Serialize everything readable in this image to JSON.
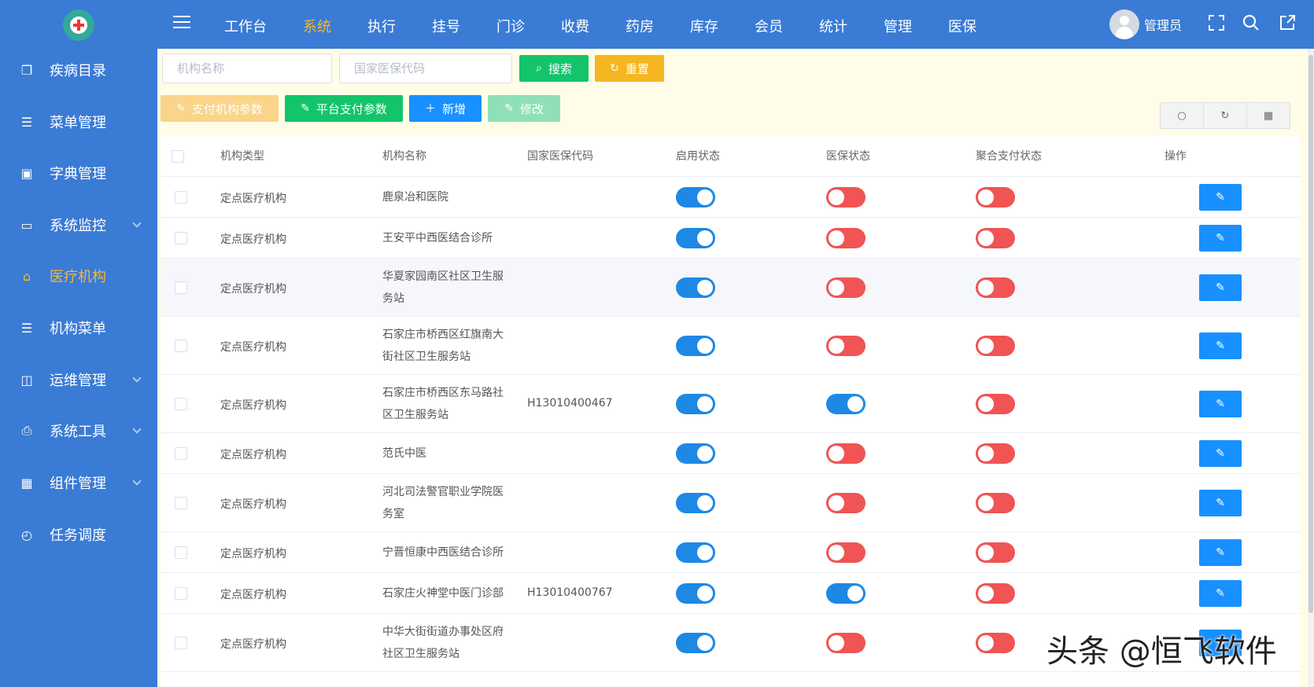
{
  "topnav": {
    "items": [
      "工作台",
      "系统",
      "执行",
      "挂号",
      "门诊",
      "收费",
      "药房",
      "库存",
      "会员",
      "统计",
      "管理",
      "医保"
    ],
    "active_index": 1
  },
  "user": {
    "name": "管理员"
  },
  "sidebar": {
    "items": [
      {
        "label": "疾病目录",
        "icon": "book-icon",
        "chevron": false
      },
      {
        "label": "菜单管理",
        "icon": "list-icon",
        "chevron": false
      },
      {
        "label": "字典管理",
        "icon": "dictionary-icon",
        "chevron": false
      },
      {
        "label": "系统监控",
        "icon": "monitor-icon",
        "chevron": true
      },
      {
        "label": "医疗机构",
        "icon": "home-icon",
        "chevron": false,
        "active": true
      },
      {
        "label": "机构菜单",
        "icon": "list-icon",
        "chevron": false
      },
      {
        "label": "运维管理",
        "icon": "screen-icon",
        "chevron": true
      },
      {
        "label": "系统工具",
        "icon": "printer-icon",
        "chevron": true
      },
      {
        "label": "组件管理",
        "icon": "grid-icon",
        "chevron": true
      },
      {
        "label": "任务调度",
        "icon": "clock-icon",
        "chevron": false
      }
    ]
  },
  "search": {
    "org_name_placeholder": "机构名称",
    "code_placeholder": "国家医保代码",
    "search_label": "搜索",
    "reset_label": "重置"
  },
  "toolbar": {
    "pay_org_params_label": "支付机构参数",
    "platform_pay_params_label": "平台支付参数",
    "add_label": "新增",
    "edit_label": "修改"
  },
  "colors": {
    "primary": "#3a7bd5",
    "accent": "#f7b731",
    "switch_on": "#1e88e5",
    "switch_off": "#f05454",
    "success": "#13c46b"
  },
  "table": {
    "columns": [
      "机构类型",
      "机构名称",
      "国家医保代码",
      "启用状态",
      "医保状态",
      "聚合支付状态",
      "操作"
    ],
    "rows": [
      {
        "type": "定点医疗机构",
        "name_lines": [
          "鹿泉冶和医院"
        ],
        "code": "",
        "enabled": true,
        "insurance": false,
        "agg_pay": false
      },
      {
        "type": "定点医疗机构",
        "name_lines": [
          "王安平中西医结合诊所"
        ],
        "code": "",
        "enabled": true,
        "insurance": false,
        "agg_pay": false
      },
      {
        "type": "定点医疗机构",
        "name_lines": [
          "华夏家园南区社区卫生服",
          "务站"
        ],
        "code": "",
        "enabled": true,
        "insurance": false,
        "agg_pay": false
      },
      {
        "type": "定点医疗机构",
        "name_lines": [
          "石家庄市桥西区红旗南大",
          "街社区卫生服务站"
        ],
        "code": "",
        "enabled": true,
        "insurance": false,
        "agg_pay": false
      },
      {
        "type": "定点医疗机构",
        "name_lines": [
          "石家庄市桥西区东马路社",
          "区卫生服务站"
        ],
        "code": "H13010400467",
        "enabled": true,
        "insurance": true,
        "agg_pay": false
      },
      {
        "type": "定点医疗机构",
        "name_lines": [
          "范氏中医"
        ],
        "code": "",
        "enabled": true,
        "insurance": false,
        "agg_pay": false
      },
      {
        "type": "定点医疗机构",
        "name_lines": [
          "河北司法警官职业学院医",
          "务室"
        ],
        "code": "",
        "enabled": true,
        "insurance": false,
        "agg_pay": false
      },
      {
        "type": "定点医疗机构",
        "name_lines": [
          "宁晋恒康中西医结合诊所"
        ],
        "code": "",
        "enabled": true,
        "insurance": false,
        "agg_pay": false
      },
      {
        "type": "定点医疗机构",
        "name_lines": [
          "石家庄火神堂中医门诊部"
        ],
        "code": "H13010400767",
        "enabled": true,
        "insurance": true,
        "agg_pay": false
      },
      {
        "type": "定点医疗机构",
        "name_lines": [
          "中华大街街道办事处区府",
          "社区卫生服务站"
        ],
        "code": "",
        "enabled": true,
        "insurance": false,
        "agg_pay": false
      }
    ]
  },
  "watermark": "头条 @恒飞软件"
}
